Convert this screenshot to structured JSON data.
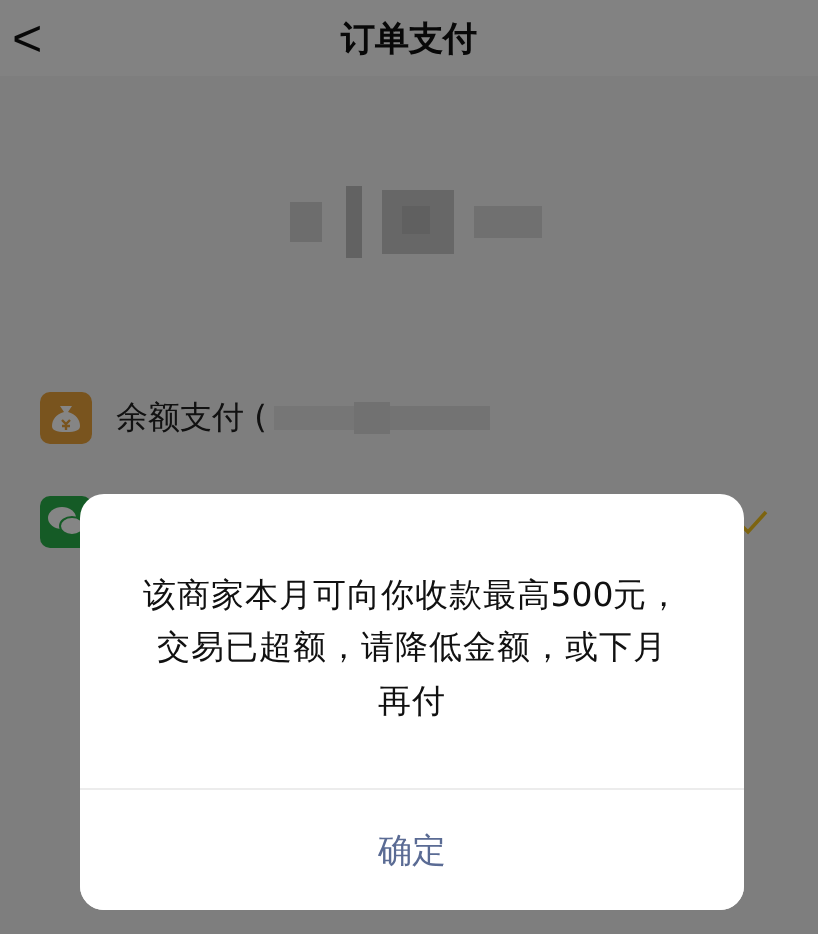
{
  "header": {
    "back": "<",
    "title": "订单支付"
  },
  "payment_methods": [
    {
      "kind": "balance",
      "label": "余额支付 (",
      "selected": false
    },
    {
      "kind": "wechat",
      "selected": true
    }
  ],
  "dialog": {
    "message": "该商家本月可向你收款最高500元，交易已超额，请降低金额，或下月再付",
    "button": "确定"
  }
}
